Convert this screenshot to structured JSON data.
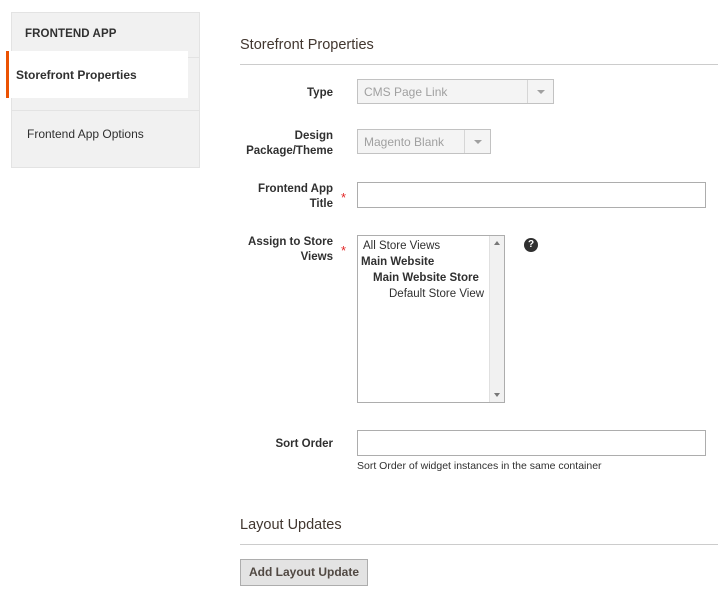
{
  "sidebar": {
    "title": "FRONTEND APP",
    "items": [
      {
        "label": "Storefront Properties",
        "active": true
      },
      {
        "label": "Frontend App Options",
        "active": false
      }
    ]
  },
  "storefront": {
    "title": "Storefront Properties",
    "type": {
      "label": "Type",
      "value": "CMS Page Link"
    },
    "theme": {
      "label": "Design Package/Theme",
      "value": "Magento Blank"
    },
    "app_title": {
      "label": "Frontend App Title",
      "value": "",
      "required": "*"
    },
    "store_views": {
      "label": "Assign to Store Views",
      "required": "*",
      "options": [
        {
          "label": "All Store Views",
          "style": "normal"
        },
        {
          "label": "Main Website",
          "style": "bold"
        },
        {
          "label": "Main Website Store",
          "style": "bold"
        },
        {
          "label": "Default Store View",
          "style": "normal"
        }
      ],
      "help": "?"
    },
    "sort_order": {
      "label": "Sort Order",
      "value": "",
      "note": "Sort Order of widget instances in the same container"
    }
  },
  "layout": {
    "title": "Layout Updates",
    "add_button": "Add Layout Update"
  },
  "colors": {
    "accent": "#eb5202",
    "required": "#e22626"
  }
}
